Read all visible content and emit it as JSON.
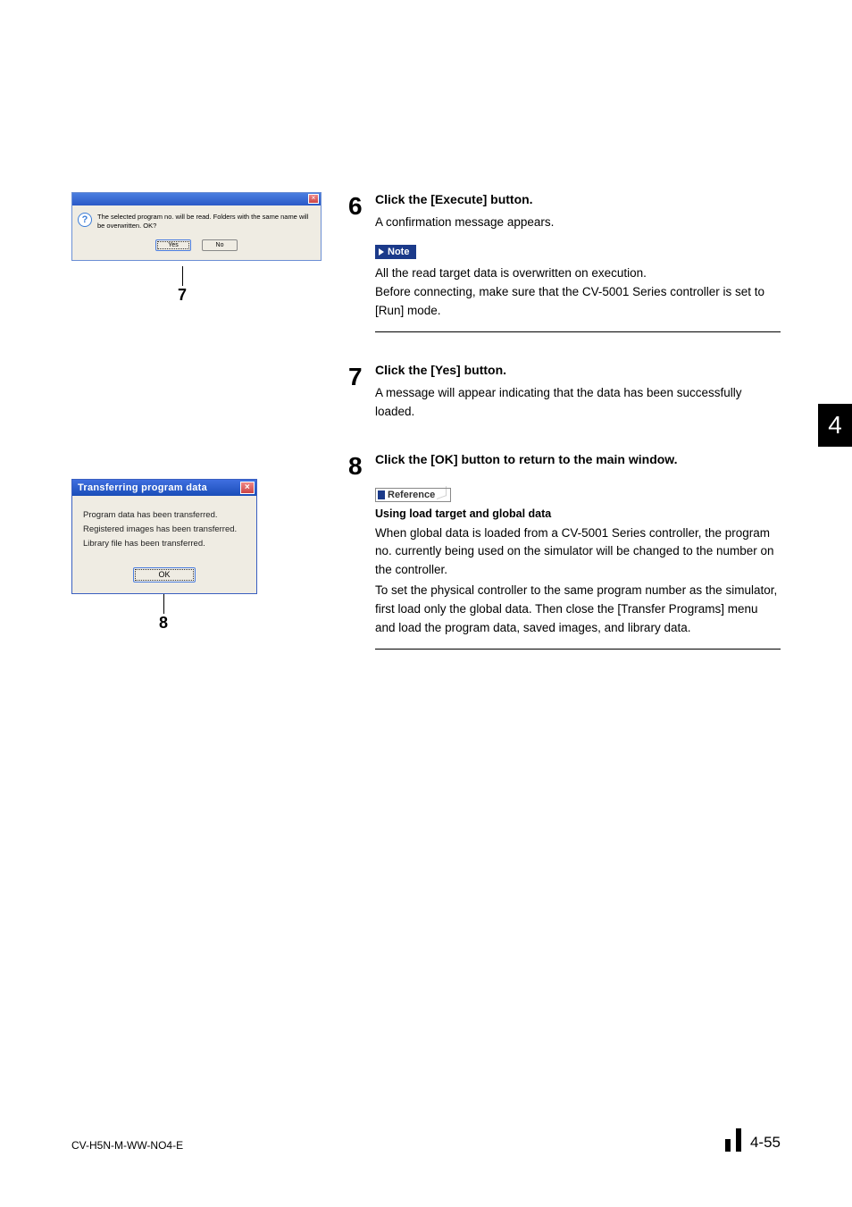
{
  "dialog1": {
    "message": "The selected program no. will be read. Folders with the same name will be overwritten. OK?",
    "yes": "Yes",
    "no": "No",
    "close": "×",
    "callout": "7"
  },
  "dialog2": {
    "title": "Transferring program data",
    "line1": "Program data has been transferred.",
    "line2": "Registered images has been transferred.",
    "line3": "Library file has been transferred.",
    "ok": "OK",
    "close": "×",
    "callout": "8"
  },
  "step6": {
    "num": "6",
    "heading": "Click the [Execute] button.",
    "text": "A confirmation message appears.",
    "noteLabel": "Note",
    "noteL1": "All the read target data is overwritten on execution.",
    "noteL2": "Before connecting, make sure that the CV-5001 Series controller is set to [Run] mode."
  },
  "step7": {
    "num": "7",
    "heading": "Click the [Yes] button.",
    "text": "A message will appear indicating that the data has been successfully loaded."
  },
  "step8": {
    "num": "8",
    "heading": "Click the [OK] button to return to the main window.",
    "refLabel": "Reference",
    "refHeading": "Using load target and global data",
    "refP1": "When global data is loaded from a CV-5001 Series controller, the program no. currently being used on the simulator will be changed to the number on the controller.",
    "refP2": "To set the physical controller to the same program number as the simulator, first load only the global data. Then close the [Transfer Programs] menu and load the program data, saved images, and library data."
  },
  "chapterTab": "4",
  "footer": {
    "left": "CV-H5N-M-WW-NO4-E",
    "right": "4-55"
  }
}
